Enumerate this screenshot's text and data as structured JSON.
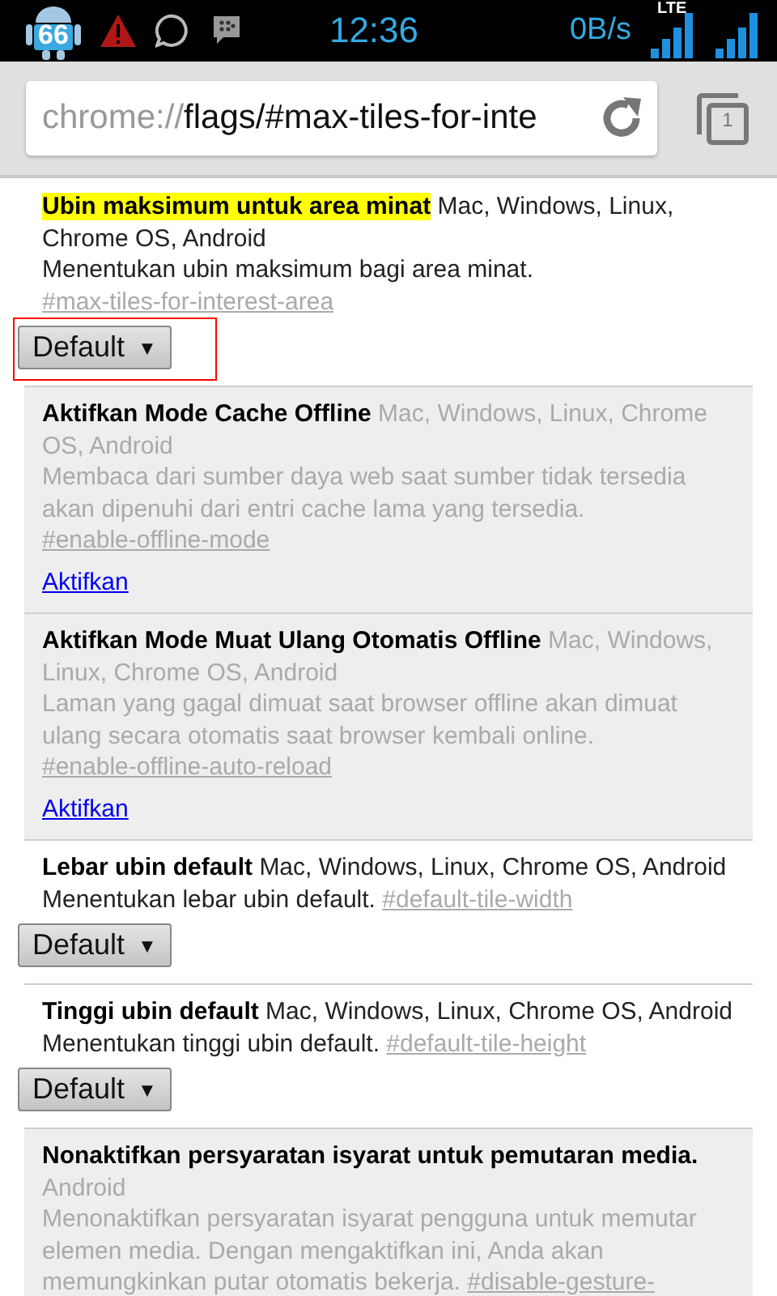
{
  "status_bar": {
    "notification_count": "66",
    "time": "12:36",
    "data_rate": "0B/s",
    "network_type": "LTE"
  },
  "toolbar": {
    "url_scheme": "chrome://",
    "url_path": "flags/#max-tiles-for-inte",
    "tab_count": "1"
  },
  "flags": [
    {
      "title": "Ubin maksimum untuk area minat",
      "platforms": "Mac, Windows, Linux, Chrome OS, Android",
      "description": "Menentukan ubin maksimum bagi area minat.",
      "anchor": "#max-tiles-for-interest-area",
      "highlighted": true,
      "disabled": false,
      "outlined": true,
      "kind": "select",
      "control": "Default",
      "arrow": "▼"
    },
    {
      "title": "Aktifkan Mode Cache Offline",
      "platforms": "Mac, Windows, Linux, Chrome OS, Android",
      "description": "Membaca dari sumber daya web saat sumber tidak tersedia akan dipenuhi dari entri cache lama yang tersedia.",
      "anchor": "#enable-offline-mode",
      "highlighted": false,
      "disabled": true,
      "kind": "link",
      "control": "Aktifkan"
    },
    {
      "title": "Aktifkan Mode Muat Ulang Otomatis Offline",
      "platforms": "Mac, Windows, Linux, Chrome OS, Android",
      "description": "Laman yang gagal dimuat saat browser offline akan dimuat ulang secara otomatis saat browser kembali online.",
      "anchor": "#enable-offline-auto-reload",
      "highlighted": false,
      "disabled": true,
      "kind": "link",
      "control": "Aktifkan"
    },
    {
      "title": "Lebar ubin default",
      "platforms": "Mac, Windows, Linux, Chrome OS, Android",
      "description": "Menentukan lebar ubin default.",
      "anchor": "#default-tile-width",
      "highlighted": false,
      "disabled": false,
      "outlined": false,
      "kind": "select",
      "control": "Default",
      "arrow": "▼"
    },
    {
      "title": "Tinggi ubin default",
      "platforms": "Mac, Windows, Linux, Chrome OS, Android",
      "description": "Menentukan tinggi ubin default.",
      "anchor": "#default-tile-height",
      "highlighted": false,
      "disabled": false,
      "outlined": false,
      "kind": "select",
      "control": "Default",
      "arrow": "▼"
    },
    {
      "title": "Nonaktifkan persyaratan isyarat untuk pemutaran media.",
      "platforms": "Android",
      "description": "Menonaktifkan persyaratan isyarat pengguna untuk memutar elemen media. Dengan mengaktifkan ini, Anda akan memungkinkan putar otomatis bekerja.",
      "anchor": "#disable-gesture-",
      "highlighted": false,
      "disabled": true,
      "kind": "none"
    }
  ]
}
